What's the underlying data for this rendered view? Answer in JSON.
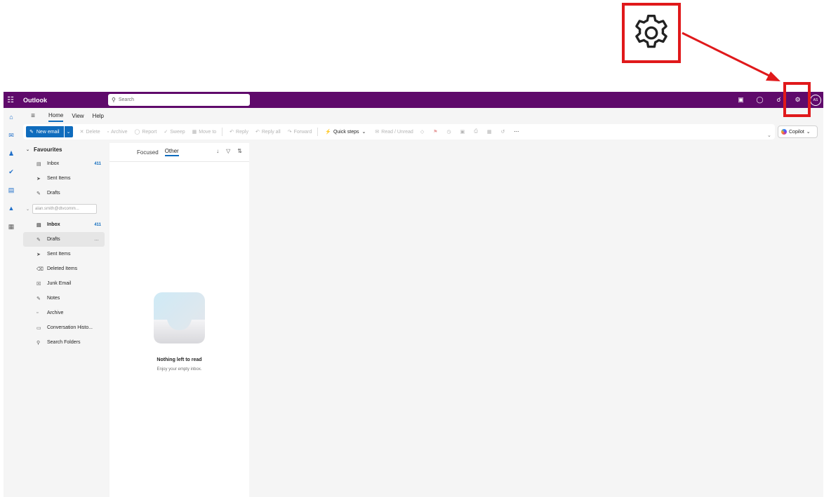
{
  "app": {
    "name": "Outlook",
    "search_placeholder": "Search",
    "avatar_initials": "AS"
  },
  "ribbon_tabs": [
    "Home",
    "View",
    "Help"
  ],
  "ribbon": {
    "new_email": "New email",
    "actions": [
      "Delete",
      "Archive",
      "Report",
      "Sweep",
      "Move to",
      "Reply",
      "Reply all",
      "Forward",
      "Quick steps",
      "Read / Unread"
    ],
    "copilot": "Copilot"
  },
  "favourites": {
    "title": "Favourites",
    "items": [
      {
        "label": "Inbox",
        "count": "411"
      },
      {
        "label": "Sent Items"
      },
      {
        "label": "Drafts"
      }
    ]
  },
  "account": {
    "email": "alan.smith@dtvcomm..."
  },
  "folders": [
    {
      "label": "Inbox",
      "count": "411"
    },
    {
      "label": "Drafts",
      "more": "…"
    },
    {
      "label": "Sent Items"
    },
    {
      "label": "Deleted Items"
    },
    {
      "label": "Junk Email"
    },
    {
      "label": "Notes"
    },
    {
      "label": "Archive"
    },
    {
      "label": "Conversation Histo..."
    },
    {
      "label": "Search Folders"
    }
  ],
  "message_list": {
    "tabs": [
      "Focused",
      "Other"
    ],
    "empty_title": "Nothing left to read",
    "empty_subtitle": "Enjoy your empty inbox."
  },
  "colors": {
    "topbar": "#5f0a6b",
    "accent": "#0f6cbd",
    "highlight": "#e0191b"
  }
}
